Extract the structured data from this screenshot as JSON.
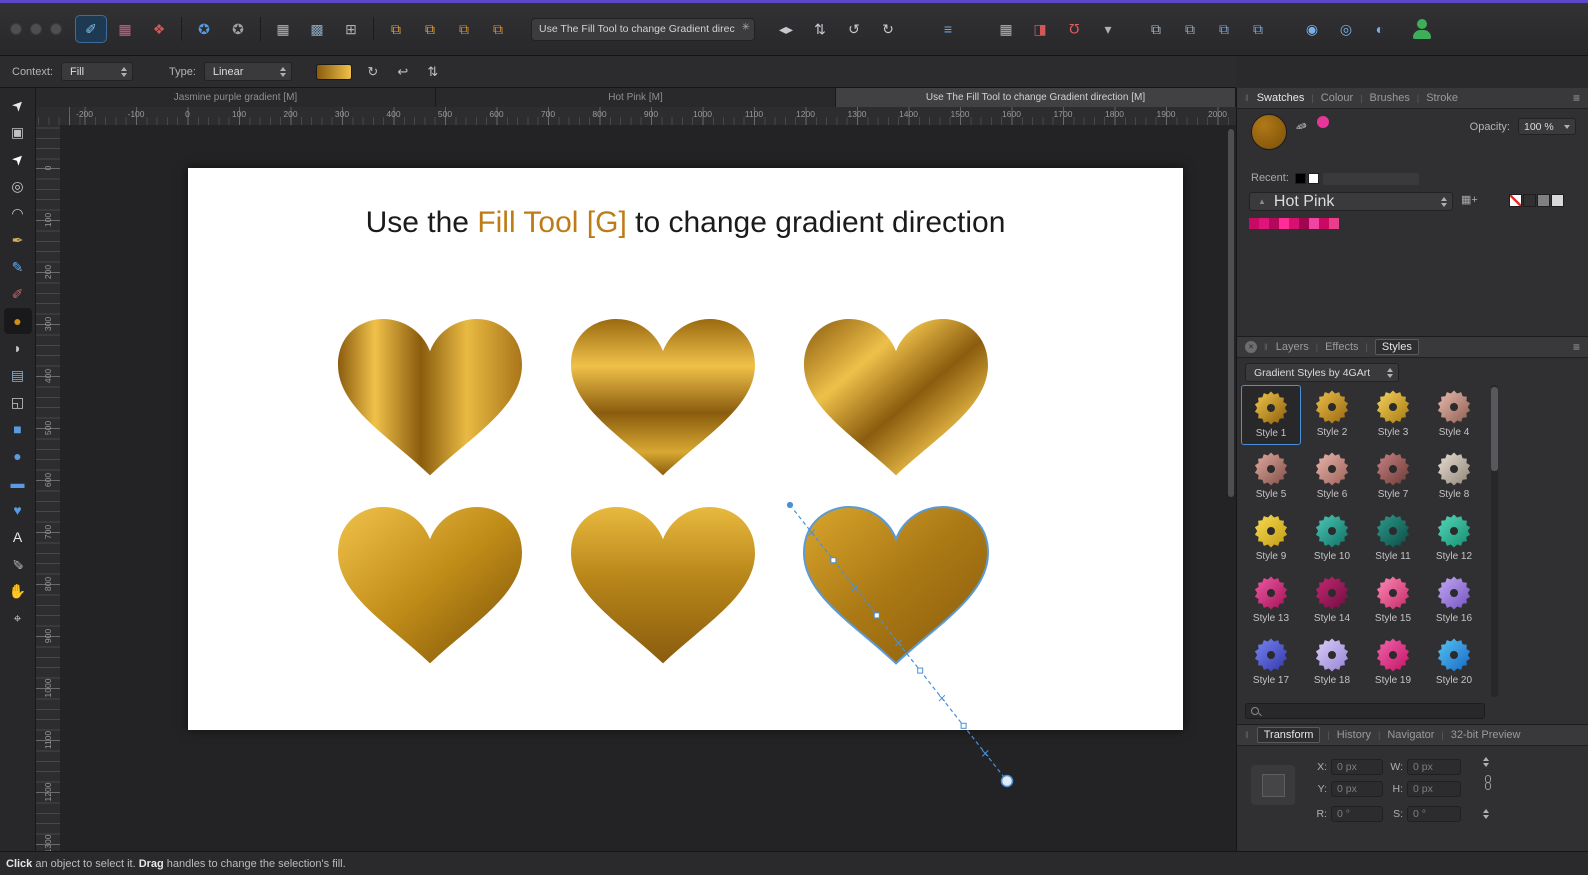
{
  "icons": {
    "hamburger": "≡",
    "drag": "‖",
    "sep": "|",
    "close": "✕",
    "eyedropper": "✎",
    "palette": "▲",
    "palette_add": "▦+"
  },
  "titlebar": {
    "traffic_lights": [
      "close",
      "minimize",
      "zoom"
    ],
    "personas": [
      {
        "name": "vector-persona",
        "glyph": "✐",
        "color": "#7ec3f0",
        "active": true
      },
      {
        "name": "pixel-persona",
        "glyph": "▦",
        "color": "#d0608a"
      },
      {
        "name": "export-persona",
        "glyph": "❖",
        "color": "#d05858"
      }
    ],
    "defaults_buttons": [
      {
        "name": "synchronise-defaults",
        "glyph": "✪",
        "color": "#5a9ae0"
      },
      {
        "name": "edit-defaults",
        "glyph": "✪",
        "color": "#a0a0a4"
      }
    ],
    "grid_buttons": [
      {
        "name": "show-grid",
        "glyph": "▦",
        "color": "#b0b0b8"
      },
      {
        "name": "snapping-grid",
        "glyph": "▩",
        "color": "#8aa8c0"
      },
      {
        "name": "edit-in-plane",
        "glyph": "⊞",
        "color": "#b0b0b8"
      }
    ],
    "order_buttons": [
      {
        "name": "move-to-front",
        "glyph": "⧉",
        "color": "#e0a040"
      },
      {
        "name": "move-forward",
        "glyph": "⧉",
        "color": "#e0a040"
      },
      {
        "name": "move-backward",
        "glyph": "⧉",
        "color": "#d89030"
      },
      {
        "name": "move-to-back",
        "glyph": "⧉",
        "color": "#d89030"
      }
    ],
    "title_field": {
      "value": "Use The Fill Tool to change Gradient direc",
      "icon": "✳"
    },
    "transform_buttons": [
      {
        "name": "flip-horizontal",
        "glyph": "◂▸",
        "color": "#c8c8d0"
      },
      {
        "name": "flip-vertical",
        "glyph": "⇅",
        "color": "#c8c8d0"
      },
      {
        "name": "rotate-anticlockwise",
        "glyph": "↺",
        "color": "#c8c8d0"
      },
      {
        "name": "rotate-clockwise",
        "glyph": "↻",
        "color": "#c8c8d0"
      }
    ],
    "alignment_buttons": [
      {
        "name": "alignment",
        "glyph": "≡",
        "color": "#6aa8e8"
      }
    ],
    "view_buttons": [
      {
        "name": "pixel-grid",
        "glyph": "▦",
        "color": "#b0b0b8"
      },
      {
        "name": "split-view",
        "glyph": "◨",
        "color": "#d05858"
      },
      {
        "name": "snapping",
        "glyph": "Ω",
        "color": "#e06060",
        "rot": 180
      },
      {
        "name": "snapping-options",
        "glyph": "▾",
        "color": "#b0b0b8"
      }
    ],
    "insert_buttons": [
      {
        "name": "duplicate",
        "glyph": "⧉",
        "color": "#a8b8c8"
      },
      {
        "name": "insert-behind",
        "glyph": "⧉",
        "color": "#98a8b8"
      },
      {
        "name": "insert-inside",
        "glyph": "⧉",
        "color": "#7aa8d8"
      },
      {
        "name": "insert-on-top",
        "glyph": "⧉",
        "color": "#7aa8d8"
      }
    ],
    "geometry_buttons": [
      {
        "name": "geometry-add",
        "glyph": "◉",
        "color": "#7ab0e8"
      },
      {
        "name": "geometry-subtract",
        "glyph": "◎",
        "color": "#7ab0e8"
      },
      {
        "name": "geometry-intersect",
        "glyph": "◐",
        "color": "#7ab0e8"
      }
    ]
  },
  "context_bar": {
    "context_label": "Context:",
    "context_value": "Fill",
    "type_label": "Type:",
    "type_value": "Linear",
    "gradient_chip_colors": [
      "#8a5c0e",
      "#f0c149"
    ],
    "fill_buttons": [
      {
        "name": "rotate-fill",
        "glyph": "↻",
        "color": "#c0c0c8"
      },
      {
        "name": "reverse-fill",
        "glyph": "↩",
        "color": "#c0c0c8"
      },
      {
        "name": "fit-fill",
        "glyph": "⇅",
        "color": "#c0c0c8"
      }
    ]
  },
  "doc_tabs": [
    {
      "label": "Jasmine purple gradient [M]",
      "active": false
    },
    {
      "label": "Hot Pink [M]",
      "active": false
    },
    {
      "label": "Use The Fill Tool to change Gradient direction [M]",
      "active": true
    }
  ],
  "ruler": {
    "unit": "px",
    "h_labels": [
      "-200",
      "-100",
      "0",
      "100",
      "200",
      "300",
      "400",
      "500",
      "600",
      "700",
      "800",
      "900",
      "1000",
      "1100",
      "1200",
      "1300",
      "1400",
      "1500",
      "1600",
      "1700",
      "1800",
      "1900",
      "2000"
    ],
    "v_labels": [
      "0",
      "100",
      "200",
      "300",
      "400",
      "500",
      "600",
      "700",
      "800",
      "900",
      "1000",
      "1100",
      "1200",
      "1300"
    ]
  },
  "tools": [
    {
      "name": "move-tool",
      "glyph": "➤",
      "color": "#e8e8e8",
      "rot": -45
    },
    {
      "name": "artboard-tool",
      "glyph": "▣",
      "color": "#c0c0c0"
    },
    {
      "name": "node-tool",
      "glyph": "➤",
      "color": "#ffffff",
      "rot": -45
    },
    {
      "name": "point-transform-tool",
      "glyph": "◎",
      "color": "#c8c8c8"
    },
    {
      "name": "corner-tool",
      "glyph": "◠",
      "color": "#c8c8c8"
    },
    {
      "name": "pen-tool",
      "glyph": "✒",
      "color": "#d8b060"
    },
    {
      "name": "pencil-tool",
      "glyph": "✎",
      "color": "#6aa8e8"
    },
    {
      "name": "vector-brush-tool",
      "glyph": "✐",
      "color": "#d06060"
    },
    {
      "name": "fill-tool",
      "glyph": "●",
      "color": "#d09018",
      "selected": true
    },
    {
      "name": "transparency-tool",
      "glyph": "◗",
      "color": "#c8c8c8"
    },
    {
      "name": "place-image-tool",
      "glyph": "▤",
      "color": "#88b0d0"
    },
    {
      "name": "vector-crop-tool",
      "glyph": "◱",
      "color": "#c8c8c8"
    },
    {
      "name": "rectangle-tool",
      "glyph": "■",
      "color": "#5a9ae0"
    },
    {
      "name": "ellipse-tool",
      "glyph": "●",
      "color": "#5a9ae0"
    },
    {
      "name": "rounded-rectangle-tool",
      "glyph": "▬",
      "color": "#5a9ae0"
    },
    {
      "name": "heart-shape-tool",
      "glyph": "♥",
      "color": "#5a9ae0"
    },
    {
      "name": "text-tool",
      "glyph": "A",
      "color": "#e8e8e8"
    },
    {
      "name": "colour-picker-tool",
      "glyph": "✎",
      "color": "#b8b8b8",
      "rot": 180
    },
    {
      "name": "hand-tool",
      "glyph": "✋",
      "color": "#c8c8c8"
    },
    {
      "name": "zoom-tool",
      "glyph": "⌖",
      "color": "#c8c8c8"
    }
  ],
  "canvas": {
    "title": {
      "pre": "Use the ",
      "highlight": "Fill Tool [G]",
      "post": " to change gradient direction",
      "highlight_color": "#bf7b16"
    },
    "selection_color": "#5b9bd5",
    "hearts": [
      {
        "name": "heart-1",
        "x1": 0,
        "y1": 0,
        "x2": 1,
        "y2": 0,
        "stops": [
          [
            "0",
            "#8a5c0e"
          ],
          [
            "0.2",
            "#f0c149"
          ],
          [
            "0.45",
            "#8a5c0e"
          ],
          [
            "0.7",
            "#e9ba42"
          ],
          [
            "1",
            "#a9751a"
          ]
        ]
      },
      {
        "name": "heart-2",
        "x1": 0,
        "y1": 0,
        "x2": 0,
        "y2": 1,
        "stops": [
          [
            "0",
            "#9a6a10"
          ],
          [
            "0.3",
            "#f0c149"
          ],
          [
            "0.6",
            "#8a5c0e"
          ],
          [
            "0.85",
            "#d8a832"
          ],
          [
            "1",
            "#8a5c0e"
          ]
        ]
      },
      {
        "name": "heart-3",
        "x1": 0,
        "y1": 0,
        "x2": 1,
        "y2": 1,
        "stops": [
          [
            "0",
            "#8a5c0e"
          ],
          [
            "0.3",
            "#eec04a"
          ],
          [
            "0.55",
            "#8a5c0e"
          ],
          [
            "0.8",
            "#eec04a"
          ],
          [
            "1",
            "#96660f"
          ]
        ]
      },
      {
        "name": "heart-4",
        "x1": 0,
        "y1": 0,
        "x2": 1,
        "y2": 1,
        "stops": [
          [
            "0",
            "#f0c24a"
          ],
          [
            "0.5",
            "#c08c18"
          ],
          [
            "1",
            "#7a5008"
          ]
        ]
      },
      {
        "name": "heart-5",
        "x1": 0,
        "y1": 0,
        "x2": 0,
        "y2": 1,
        "stops": [
          [
            "0",
            "#e8b93e"
          ],
          [
            "0.45",
            "#b8861a"
          ],
          [
            "1",
            "#8a5c0e"
          ]
        ]
      },
      {
        "name": "heart-6",
        "x1": 0,
        "y1": 0,
        "x2": 1,
        "y2": 1,
        "selected": true,
        "stops": [
          [
            "0",
            "#d8a52c"
          ],
          [
            "0.5",
            "#aa7814"
          ],
          [
            "1",
            "#8a5c0e"
          ]
        ]
      }
    ]
  },
  "swatches_panel": {
    "tabs": [
      {
        "label": "Swatches",
        "active": true
      },
      {
        "label": "Colour"
      },
      {
        "label": "Brushes"
      },
      {
        "label": "Stroke"
      }
    ],
    "fill_color": "#b07818",
    "secondary_color": "#e8359a",
    "opacity_label": "Opacity:",
    "opacity_value": "100 %",
    "recent_label": "Recent:",
    "recent_chips": [
      "#000000",
      "#ffffff"
    ],
    "palette_name": "Hot Pink",
    "palette_chips": [
      "#c80a64",
      "#e0157c",
      "#b4085a",
      "#ff2d96",
      "#d81070",
      "#a00650",
      "#f044a0",
      "#c80a64",
      "#e83e8c"
    ],
    "utility_chips": [
      "none",
      "#303030",
      "#808080",
      "#d8d8d8"
    ]
  },
  "styles_panel": {
    "tabs": [
      {
        "label": "Layers"
      },
      {
        "label": "Effects"
      },
      {
        "label": "Styles",
        "active": true
      }
    ],
    "category": "Gradient Styles by 4GArt",
    "items": [
      {
        "label": "Style 1",
        "c1": "#f2c94c",
        "c2": "#8a5a0c",
        "selected": true
      },
      {
        "label": "Style 2",
        "c1": "#eec04a",
        "c2": "#96660e"
      },
      {
        "label": "Style 3",
        "c1": "#f6d45e",
        "c2": "#a5770f"
      },
      {
        "label": "Style 4",
        "c1": "#e9bcb0",
        "c2": "#8d5c50"
      },
      {
        "label": "Style 5",
        "c1": "#e2aaa2",
        "c2": "#7e4e46"
      },
      {
        "label": "Style 6",
        "c1": "#eab6ae",
        "c2": "#9a6055"
      },
      {
        "label": "Style 7",
        "c1": "#c98383",
        "c2": "#6b3a36"
      },
      {
        "label": "Style 8",
        "c1": "#e8ded2",
        "c2": "#8e8478"
      },
      {
        "label": "Style 9",
        "c1": "#f8dc52",
        "c2": "#c09a14"
      },
      {
        "label": "Style 10",
        "c1": "#4ecab8",
        "c2": "#0e6e62"
      },
      {
        "label": "Style 11",
        "c1": "#2e9c8c",
        "c2": "#0c4a44"
      },
      {
        "label": "Style 12",
        "c1": "#56d8bc",
        "c2": "#148c6c"
      },
      {
        "label": "Style 13",
        "c1": "#f05aa4",
        "c2": "#a01254"
      },
      {
        "label": "Style 14",
        "c1": "#c42874",
        "c2": "#6e0e3e"
      },
      {
        "label": "Style 15",
        "c1": "#ff8ab8",
        "c2": "#c22a66"
      },
      {
        "label": "Style 16",
        "c1": "#c4aaf2",
        "c2": "#7252c2"
      },
      {
        "label": "Style 17",
        "c1": "#7686f2",
        "c2": "#3436a6"
      },
      {
        "label": "Style 18",
        "c1": "#dcccfa",
        "c2": "#9284d2"
      },
      {
        "label": "Style 19",
        "c1": "#f264ac",
        "c2": "#c21464"
      },
      {
        "label": "Style 20",
        "c1": "#58c4f2",
        "c2": "#1668c4"
      }
    ],
    "search_value": ""
  },
  "panel_tabs": [
    {
      "label": "Transform",
      "active": true
    },
    {
      "label": "History"
    },
    {
      "label": "Navigator"
    },
    {
      "label": "32-bit Preview"
    }
  ],
  "transform": {
    "rows": [
      [
        {
          "label": "X:",
          "value": "0 px"
        },
        {
          "label": "W:",
          "value": "0 px"
        }
      ],
      [
        {
          "label": "Y:",
          "value": "0 px"
        },
        {
          "label": "H:",
          "value": "0 px"
        }
      ],
      [
        {
          "label": "R:",
          "value": "0 °"
        },
        {
          "label": "S:",
          "value": "0 °"
        }
      ]
    ]
  },
  "status_bar": {
    "segments": [
      {
        "text": "Click",
        "bold": true
      },
      {
        "text": " an object to select it. "
      },
      {
        "text": "Drag",
        "bold": true
      },
      {
        "text": " handles to change the selection's fill."
      }
    ]
  }
}
